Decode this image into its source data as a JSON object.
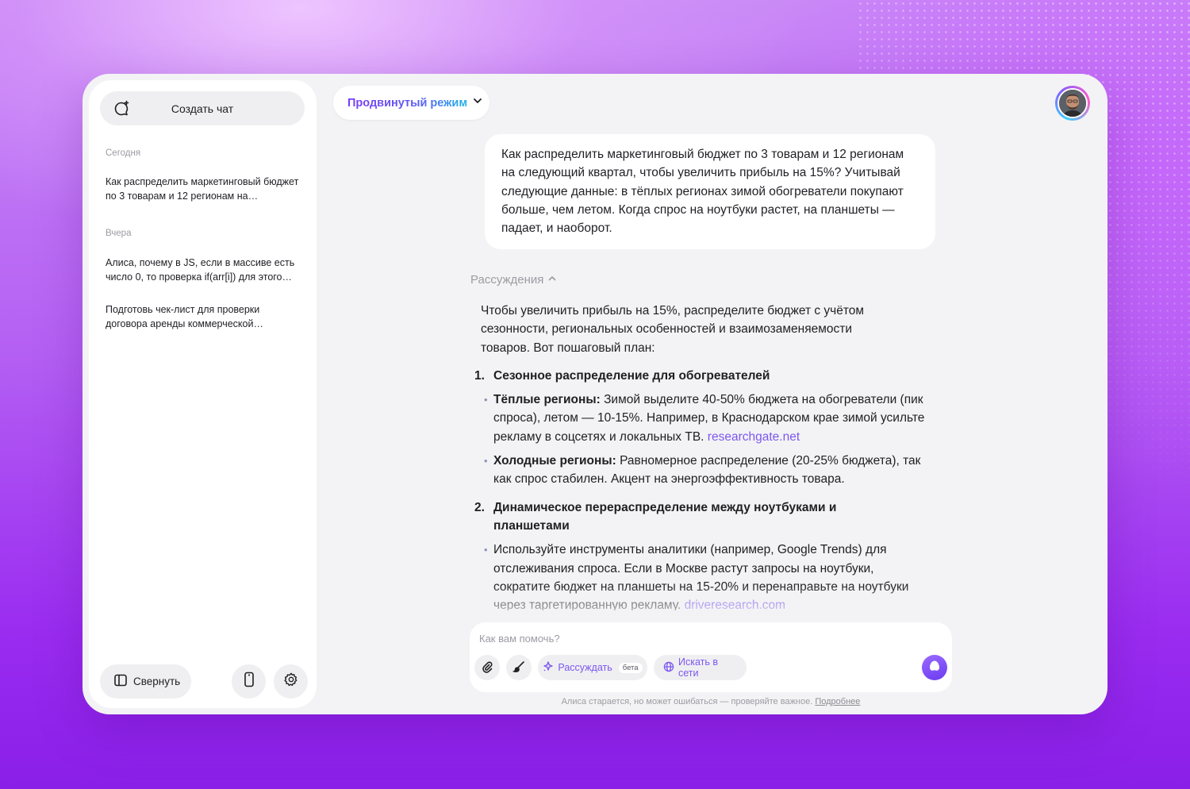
{
  "sidebar": {
    "new_chat_label": "Создать чат",
    "groups": [
      {
        "label": "Сегодня",
        "items": [
          "Как распределить маркетинговый бюджет по 3 товарам и 12 регионам на следующий квартал"
        ]
      },
      {
        "label": "Вчера",
        "items": [
          "Алиса, почему в JS, если в массиве есть число 0, то проверка if(arr[i]) для этого элемента",
          "Подготовь чек-лист для проверки договора аренды коммерческой недвижимости"
        ]
      }
    ],
    "collapse_label": "Свернуть",
    "icons": {
      "new_chat": "chat-plus-icon",
      "collapse": "sidebar-panel-icon",
      "phone": "phone-icon",
      "settings": "gear-icon"
    }
  },
  "header": {
    "mode_label": "Продвинутый режим",
    "mode_icon": "chevron-down-icon",
    "avatar": "user-avatar"
  },
  "chat": {
    "user_message": "Как распределить маркетинговый бюджет по 3 товарам и 12 регионам на следующий квартал, чтобы увеличить прибыль на 15%? Учитывай следующие данные: в тёплых регионах зимой обогреватели покупают больше, чем летом. Когда спрос на ноутбуки растет, на планшеты — падает, и наоборот.",
    "reasoning_label": "Рассуждения",
    "answer": {
      "intro": "Чтобы увеличить прибыль на 15%, распределите бюджет с учётом сезонности, региональных особенностей и взаимозаменяемости товаров. Вот пошаговый план:",
      "sections": [
        {
          "number": "1.",
          "title": "Сезонное распределение для обогревателей",
          "bullets": [
            {
              "bold": "Тёплые регионы:",
              "text": " Зимой выделите 40-50% бюджета на обогреватели (пик спроса), летом — 10-15%. Например, в Краснодарском крае зимой усильте рекламу в соцсетях и локальных ТВ. ",
              "link": "researchgate.net"
            },
            {
              "bold": "Холодные регионы:",
              "text": " Равномерное распределение (20-25% бюджета), так как спрос стабилен. Акцент на энергоэффективность товара.",
              "link": ""
            }
          ]
        },
        {
          "number": "2.",
          "title": "Динамическое перераспределение между ноутбуками и планшетами",
          "bullets": [
            {
              "bold": "",
              "text": "Используйте инструменты аналитики (например, Google Trends) для отслеживания спроса. Если в Москве растут запросы на ноутбуки, сократите бюджет на планшеты на 15-20% и перенаправьте на ноутбуки через таргетированную рекламу. ",
              "link": "driveresearch.com"
            }
          ]
        }
      ]
    }
  },
  "composer": {
    "placeholder": "Как вам помочь?",
    "reason_label": "Рассуждать",
    "beta_label": "бета",
    "search_label": "Искать в сети",
    "icons": {
      "attach": "paperclip-icon",
      "draw": "brush-icon",
      "reason": "sparkle-icon",
      "search": "globe-icon",
      "send": "alice-send-icon"
    }
  },
  "footer": {
    "disclaimer": "Алиса старается, но может ошибаться — проверяйте важное.",
    "more_link": "Подробнее"
  },
  "colors": {
    "accent": "#7d57f0",
    "background_top": "#c98af6",
    "background_bottom": "#8a1fe8",
    "panel": "#f3f3f5"
  }
}
